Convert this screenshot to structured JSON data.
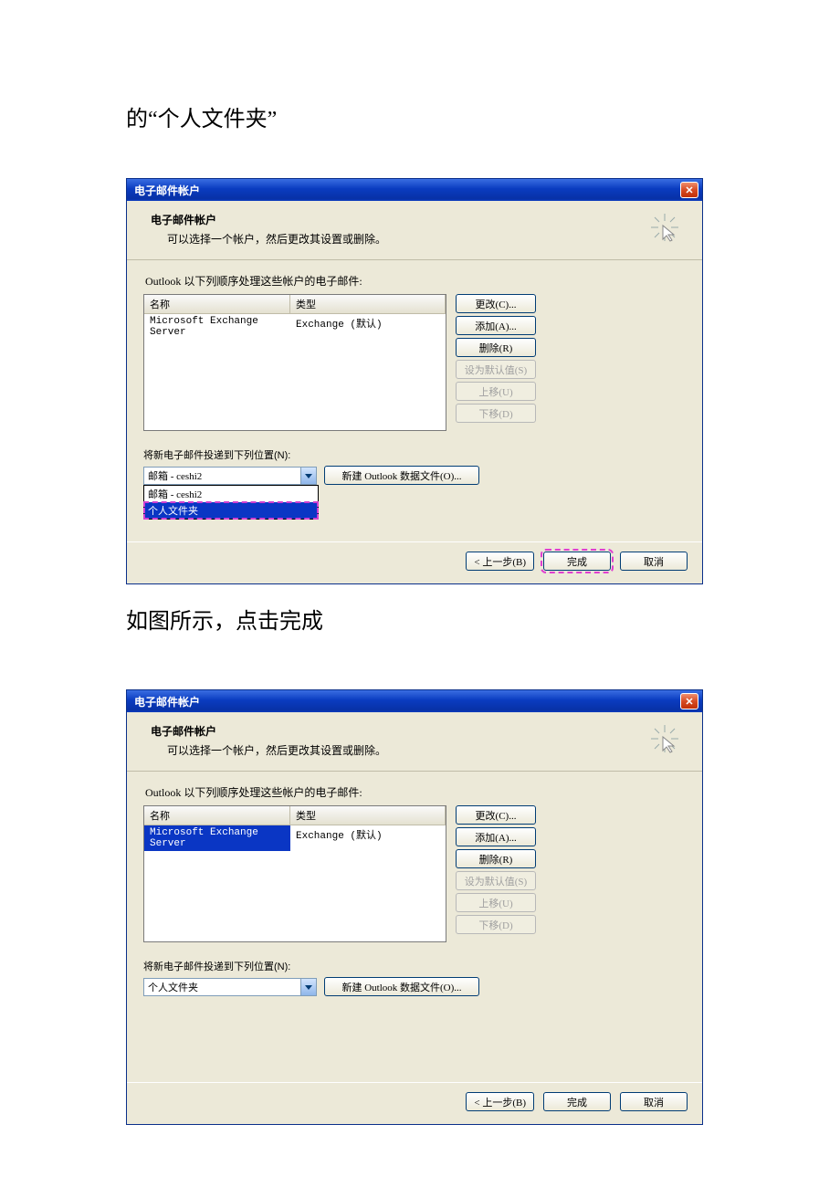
{
  "doc": {
    "text_top": "的“个人文件夹”",
    "text_mid": "如图所示，点击完成"
  },
  "dialog1": {
    "title": "电子邮件帐户",
    "header_title": "电子邮件帐户",
    "header_sub": "可以选择一个帐户，然后更改其设置或删除。",
    "instr": "Outlook 以下列顺序处理这些帐户的电子邮件:",
    "th_name": "名称",
    "th_type": "类型",
    "row_name": "Microsoft Exchange Server",
    "row_type": "Exchange (默认)",
    "btn_change": "更改(C)...",
    "btn_add": "添加(A)...",
    "btn_remove": "删除(R)",
    "btn_default": "设为默认值(S)",
    "btn_up": "上移(U)",
    "btn_down": "下移(D)",
    "deliver_label": "将新电子邮件投递到下列位置(N):",
    "combo_value": "邮箱 - ceshi2",
    "dd_item1": "邮箱 - ceshi2",
    "dd_item2": "个人文件夹",
    "btn_newfile": "新建 Outlook 数据文件(O)...",
    "btn_back": "上一步(B)",
    "btn_finish": "完成",
    "btn_cancel": "取消"
  },
  "dialog2": {
    "title": "电子邮件帐户",
    "header_title": "电子邮件帐户",
    "header_sub": "可以选择一个帐户，然后更改其设置或删除。",
    "instr": "Outlook 以下列顺序处理这些帐户的电子邮件:",
    "th_name": "名称",
    "th_type": "类型",
    "row_name": "Microsoft Exchange Server",
    "row_type": "Exchange (默认)",
    "btn_change": "更改(C)...",
    "btn_add": "添加(A)...",
    "btn_remove": "删除(R)",
    "btn_default": "设为默认值(S)",
    "btn_up": "上移(U)",
    "btn_down": "下移(D)",
    "deliver_label": "将新电子邮件投递到下列位置(N):",
    "combo_value": "个人文件夹",
    "btn_newfile": "新建 Outlook 数据文件(O)...",
    "btn_back": "上一步(B)",
    "btn_finish": "完成",
    "btn_cancel": "取消"
  }
}
